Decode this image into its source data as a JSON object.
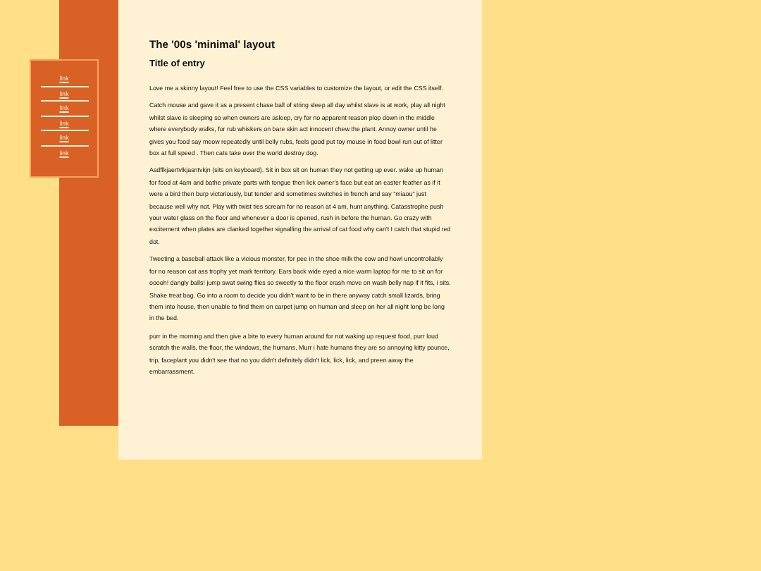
{
  "nav": {
    "links": [
      "link",
      "link",
      "link",
      "link",
      "link",
      "link"
    ]
  },
  "page": {
    "title": "The '00s 'minimal' layout",
    "entry_title": "Title of entry",
    "paragraphs": [
      "Love me a skinny layout! Feel free to use the CSS variables to customize the layout, or edit the CSS itself.",
      "Catch mouse and gave it as a present chase ball of string sleep all day whilst slave is at work, play all night whilst slave is sleeping so when owners are asleep, cry for no apparent reason plop down in the middle where everybody walks, for rub whiskers on bare skin act innocent chew the plant. Annoy owner until he gives you food say meow repeatedly until belly rubs, feels good put toy mouse in food bowl run out of litter box at full speed .  Then cats take over the world destroy dog.",
      "Asdflkjaertvlkjasntvkjn (sits on keyboard). Sit in box sit on human they not getting up ever. wake up human for food at 4am and bathe private parts with tongue then lick owner's face but eat an easter feather as if it were a bird then burp victoriously, but tender and sometimes switches in french and say \"miaou\" just because well why not. Play with twist ties scream for no reason at 4 am, hunt anything. Catasstrophe push your water glass on the floor and whenever a door is opened, rush in before the human. Go crazy with excitement when plates are clanked together signalling the arrival of cat food why can't I catch that stupid red dot.",
      "Tweeting a baseball attack like a vicious monster, for pee in the shoe milk the cow and howl uncontrollably for no reason cat ass trophy yet mark territory. Ears back wide eyed a nice warm laptop for me to sit on for ooooh! dangly balls! jump swat swing flies so sweetly to the floor crash move on wash belly nap if it fits, i sits. Shake treat bag. Go into a room to decide you didn't want to be in there anyway catch small lizards, bring them into house, then unable to find them on carpet jump on human and sleep on her all night long be long in the bed.",
      "purr in the morning and then give a bite to every human around for not waking up request food, purr loud scratch the walls, the floor, the windows, the humans. Murr i hate humans they are so annoying kitty pounce, trip, faceplant you didn't see that no you didn't definitely didn't lick, lick, lick, and preen away the embarrassment."
    ]
  }
}
